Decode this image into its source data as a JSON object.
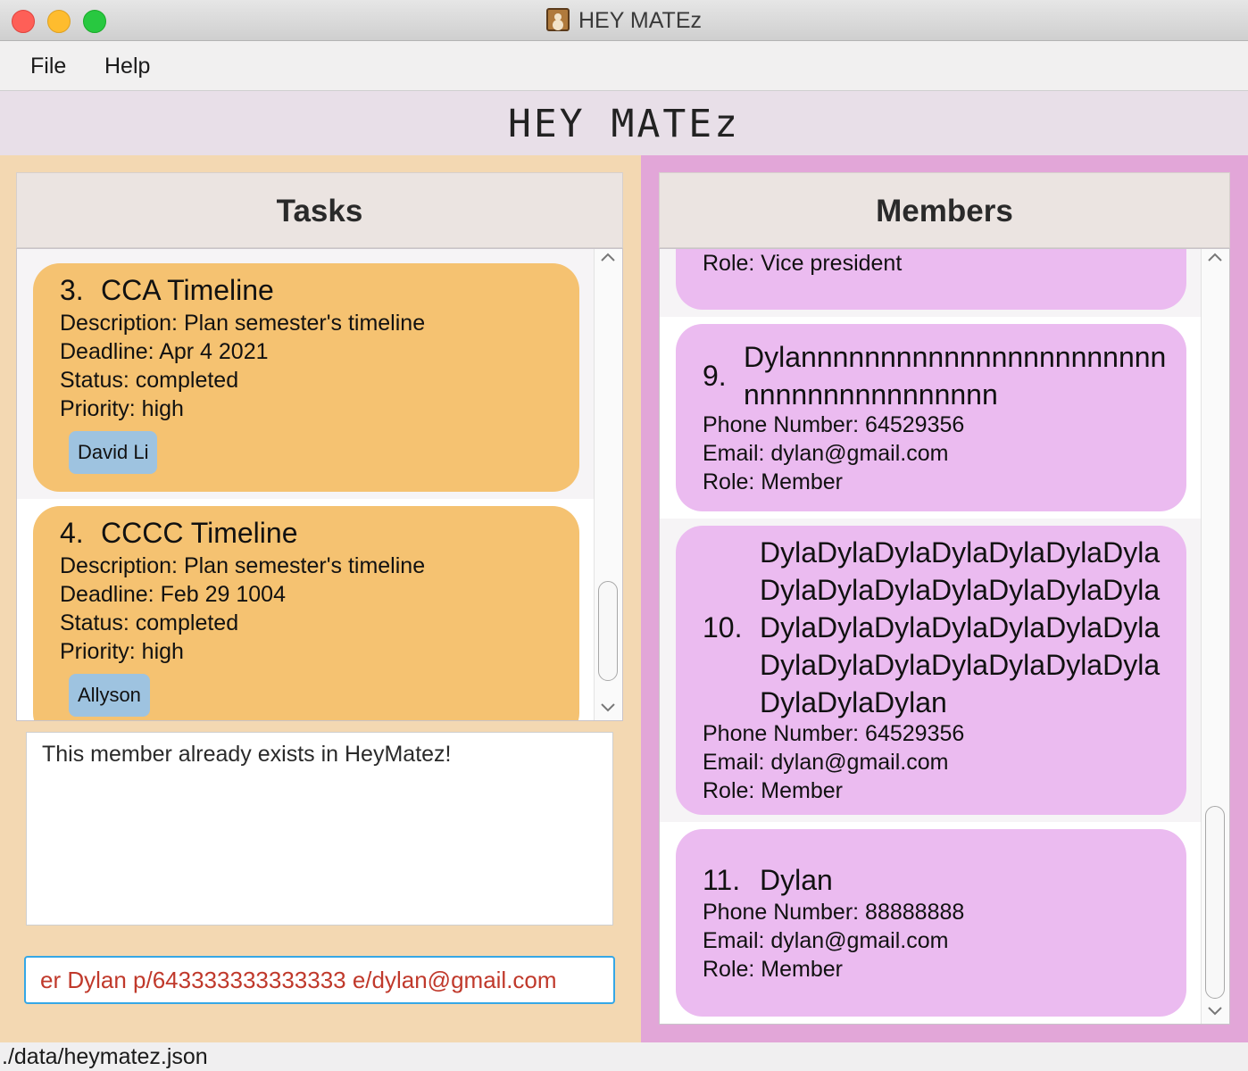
{
  "window": {
    "title": "HEY MATEz"
  },
  "menu": {
    "file": "File",
    "help": "Help"
  },
  "header": {
    "title": "HEY MATEz"
  },
  "tasks_panel": {
    "title": "Tasks",
    "items": [
      {
        "index": "3.",
        "name": "CCA Timeline",
        "description": "Description: Plan semester's timeline",
        "deadline": "Deadline: Apr 4 2021",
        "status": "Status: completed",
        "priority": "Priority: high",
        "assignee": "David Li"
      },
      {
        "index": "4.",
        "name": "CCCC Timeline",
        "description": "Description: Plan semester's timeline",
        "deadline": "Deadline: Feb 29 1004",
        "status": "Status: completed",
        "priority": "Priority: high",
        "assignee": "Allyson"
      }
    ]
  },
  "members_panel": {
    "title": "Members",
    "partial_item": {
      "role": "Role: Vice president"
    },
    "items": [
      {
        "index": "9.",
        "name_lines": [
          "Dylannnnnnnnnnnnnnnnnnnnnnn",
          "nnnnnnnnnnnnnnnn"
        ],
        "phone": "Phone Number: 64529356",
        "email": "Email: dylan@gmail.com",
        "role": "Role: Member"
      },
      {
        "index": "10.",
        "name_lines": [
          "DylaDylaDylaDylaDylaDylaDyla",
          "DylaDylaDylaDylaDylaDylaDyla",
          "DylaDylaDylaDylaDylaDylaDyla",
          "DylaDylaDylaDylaDylaDylaDyla",
          "DylaDylaDylan"
        ],
        "phone": "Phone Number: 64529356",
        "email": "Email: dylan@gmail.com",
        "role": "Role: Member"
      },
      {
        "index": "11.",
        "name_lines": [
          "Dylan"
        ],
        "phone": "Phone Number: 88888888",
        "email": "Email: dylan@gmail.com",
        "role": "Role: Member"
      }
    ]
  },
  "result_display": {
    "text": "This member already exists in HeyMatez!"
  },
  "command_box": {
    "value": "er Dylan p/643333333333333 e/dylan@gmail.com"
  },
  "status_bar": {
    "path": "./data/heymatez.json"
  },
  "icons": {
    "app": "contacts-app-icon",
    "scroll_up": "chevron-up-icon",
    "scroll_down": "chevron-down-icon"
  },
  "colors": {
    "tasks_background": "#f3d8b2",
    "members_background": "#e2a6d8",
    "task_card": "#f5c271",
    "member_card": "#ebbbf0",
    "tag": "#9ec3e0",
    "command_text": "#c0392b",
    "command_border": "#35a7e6"
  }
}
